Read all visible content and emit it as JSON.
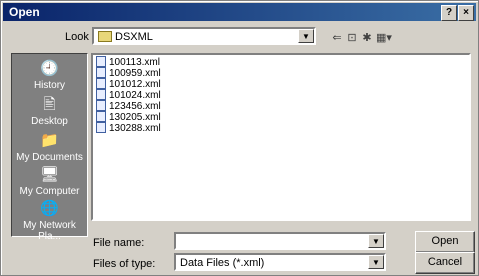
{
  "window": {
    "title": "Open",
    "help_glyph": "?",
    "close_glyph": "×"
  },
  "lookin": {
    "label": "Look in:",
    "value": "DSXML"
  },
  "toolbar": {
    "back_glyph": "⇐",
    "up_glyph": "⊡",
    "newfolder_glyph": "✱",
    "views_glyph": "▦▾"
  },
  "places": [
    {
      "label": "History",
      "icon": "history-icon",
      "glyph": "🕘"
    },
    {
      "label": "Desktop",
      "icon": "desktop-icon",
      "glyph": "🖹"
    },
    {
      "label": "My Documents",
      "icon": "my-documents-icon",
      "glyph": "📁"
    },
    {
      "label": "My Computer",
      "icon": "my-computer-icon",
      "glyph": "🖥"
    },
    {
      "label": "My Network Pla...",
      "icon": "network-places-icon",
      "glyph": "🌐"
    }
  ],
  "files": [
    "100113.xml",
    "100959.xml",
    "101012.xml",
    "101024.xml",
    "123456.xml",
    "130205.xml",
    "130288.xml"
  ],
  "filename": {
    "label": "File name:",
    "value": ""
  },
  "filetype": {
    "label": "Files of type:",
    "value": "Data Files (*.xml)"
  },
  "buttons": {
    "open": "Open",
    "cancel": "Cancel"
  },
  "colors": {
    "title_bar": "#0a246a",
    "dialog_bg": "#d4d0c8",
    "places_bg": "#808080"
  }
}
